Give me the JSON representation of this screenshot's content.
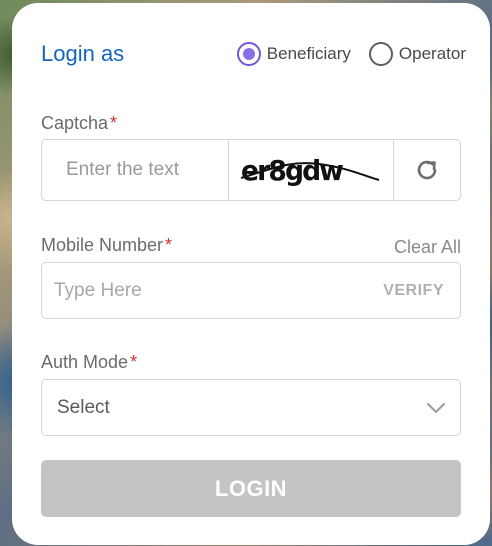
{
  "header": {
    "title": "Login as",
    "options": [
      {
        "label": "Beneficiary",
        "checked": true
      },
      {
        "label": "Operator",
        "checked": false
      }
    ]
  },
  "captcha": {
    "label": "Captcha",
    "required_mark": "*",
    "placeholder": "Enter the text",
    "image_text": "er8gdw",
    "refresh_icon": "refresh-icon"
  },
  "mobile": {
    "label": "Mobile Number",
    "required_mark": "*",
    "clear_label": "Clear All",
    "placeholder": "Type Here",
    "verify_label": "VERIFY"
  },
  "auth": {
    "label": "Auth Mode",
    "required_mark": "*",
    "selected": "Select",
    "chevron_icon": "chevron-down-icon"
  },
  "login": {
    "label": "LOGIN"
  },
  "colors": {
    "accent": "#1565c0",
    "radio_selected": "#7257d8",
    "required": "#d32f2f",
    "button_disabled": "#c4c4c4"
  }
}
